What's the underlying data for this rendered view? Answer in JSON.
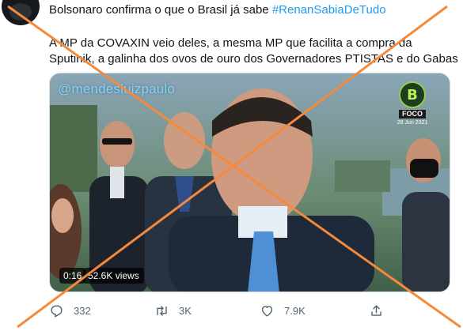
{
  "tweet": {
    "text_line1": "Bolsonaro confirma o que o Brasil já sabe ",
    "hashtag": "#RenanSabiaDeTudo",
    "text_line2": "A MP da COVAXIN veio deles, a mesma MP que facilita a compra da",
    "text_line3": "Sputinik, a galinha dos ovos de ouro dos Governadores PTISTAS e do Gabas"
  },
  "video": {
    "watermark": "@mendesluizpaulo",
    "channel_letter": "B",
    "channel_name": "FOCO",
    "channel_date": "28 Jun 2021",
    "elapsed": "0:16",
    "views": "52.6K views"
  },
  "actions": {
    "reply_icon": "reply-icon",
    "reply_count": "332",
    "retweet_icon": "retweet-icon",
    "retweet_count": "3K",
    "like_icon": "like-icon",
    "like_count": "7.9K",
    "share_icon": "share-icon"
  },
  "overlay": {
    "type": "false-claim-x",
    "color": "#f58a3c"
  },
  "colors": {
    "link": "#1d9bf0",
    "meta": "#536471",
    "text": "#0f1419"
  }
}
